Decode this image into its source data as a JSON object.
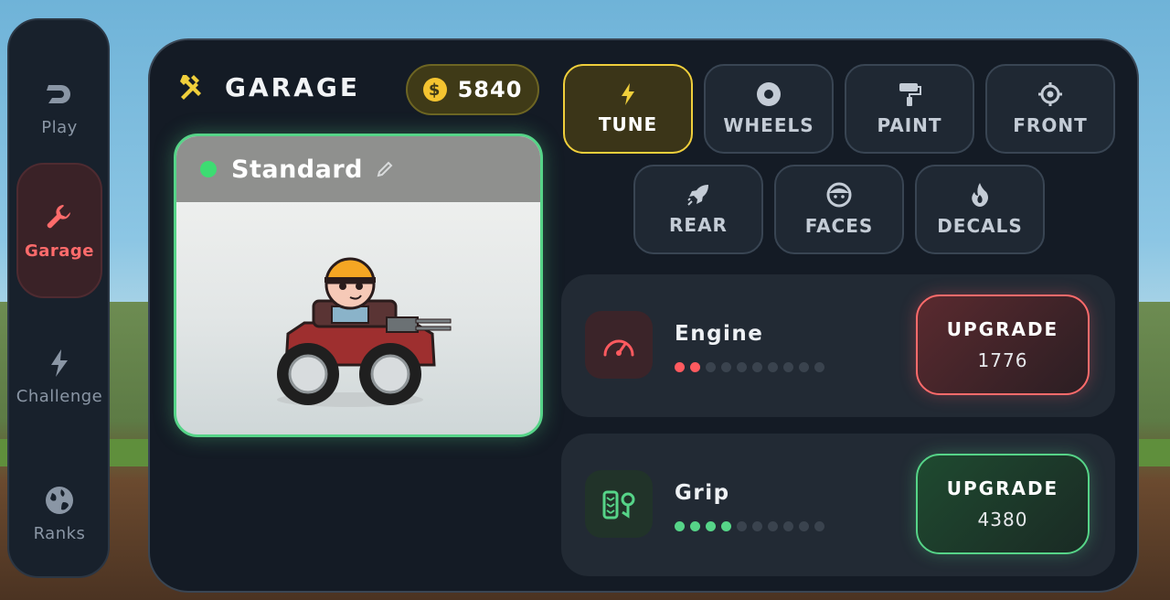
{
  "sidebar": {
    "items": [
      {
        "label": "Play",
        "icon": "play-logo-icon"
      },
      {
        "label": "Garage",
        "icon": "wrench-icon",
        "active": true
      },
      {
        "label": "Challenge",
        "icon": "lightning-icon"
      },
      {
        "label": "Ranks",
        "icon": "globe-icon"
      }
    ]
  },
  "header": {
    "title": "GARAGE",
    "title_icon": "tools-icon",
    "coins": "5840",
    "coin_icon": "dollar-coin-icon"
  },
  "car": {
    "name": "Standard",
    "status_color": "#3ddc72",
    "edit_icon": "pencil-icon"
  },
  "tabs": [
    {
      "label": "TUNE",
      "icon": "bolt-icon",
      "active": true
    },
    {
      "label": "WHEELS",
      "icon": "wheel-icon"
    },
    {
      "label": "PAINT",
      "icon": "paint-roller-icon"
    },
    {
      "label": "FRONT",
      "icon": "crosshair-icon"
    },
    {
      "label": "REAR",
      "icon": "rocket-icon"
    },
    {
      "label": "FACES",
      "icon": "face-icon"
    },
    {
      "label": "DECALS",
      "icon": "flame-icon"
    }
  ],
  "stats": [
    {
      "label": "Engine",
      "icon": "speedometer-icon",
      "level": 2,
      "max": 10,
      "upgrade_label": "UPGRADE",
      "cost": "1776",
      "color": "#ff5a5f"
    },
    {
      "label": "Grip",
      "icon": "tire-track-icon",
      "level": 4,
      "max": 10,
      "upgrade_label": "UPGRADE",
      "cost": "4380",
      "color": "#56d488"
    }
  ],
  "colors": {
    "accent_yellow": "#f0cf3b",
    "accent_red": "#ff6b6b",
    "accent_green": "#56d488",
    "panel": "#141b25"
  }
}
